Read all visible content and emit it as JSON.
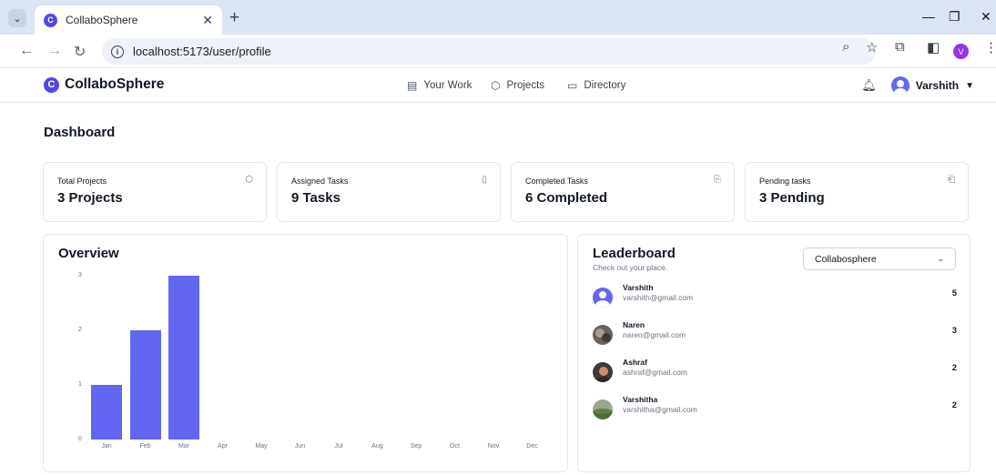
{
  "browser": {
    "tab_title": "CollaboSphere",
    "url": "localhost:5173/user/profile"
  },
  "header": {
    "brand": "CollaboSphere",
    "nav": [
      "Your Work",
      "Projects",
      "Directory"
    ],
    "user_name": "Varshith",
    "profile_letter": "V"
  },
  "dashboard": {
    "title": "Dashboard",
    "cards": [
      {
        "label": "Total Projects",
        "value": "3 Projects"
      },
      {
        "label": "Assigned Tasks",
        "value": "9 Tasks"
      },
      {
        "label": "Completed Tasks",
        "value": "6 Completed"
      },
      {
        "label": "Pending tasks",
        "value": "3 Pending"
      }
    ]
  },
  "overview": {
    "title": "Overview"
  },
  "chart_data": {
    "type": "bar",
    "categories": [
      "Jan",
      "Feb",
      "Mar",
      "Apr",
      "May",
      "Jun",
      "Jul",
      "Aug",
      "Sep",
      "Oct",
      "Nov",
      "Dec"
    ],
    "values": [
      1,
      2,
      3,
      0,
      0,
      0,
      0,
      0,
      0,
      0,
      0,
      0
    ],
    "yticks": [
      "0",
      "1",
      "2",
      "3"
    ],
    "ylim": [
      0,
      3
    ],
    "color": "#6366f1"
  },
  "leaderboard": {
    "title": "Leaderboard",
    "subtitle": "Check out your place.",
    "selected": "Collabosphere",
    "rows": [
      {
        "name": "Varshith",
        "email": "varshith@gmail.com",
        "score": "5"
      },
      {
        "name": "Naren",
        "email": "naren@gmail.com",
        "score": "3"
      },
      {
        "name": "Ashraf",
        "email": "ashraf@gmail.com",
        "score": "2"
      },
      {
        "name": "Varshitha",
        "email": "varshitha@gmail.com",
        "score": "2"
      }
    ]
  },
  "colors": {
    "accent": "#6366f1",
    "brand": "#4f46e5"
  }
}
